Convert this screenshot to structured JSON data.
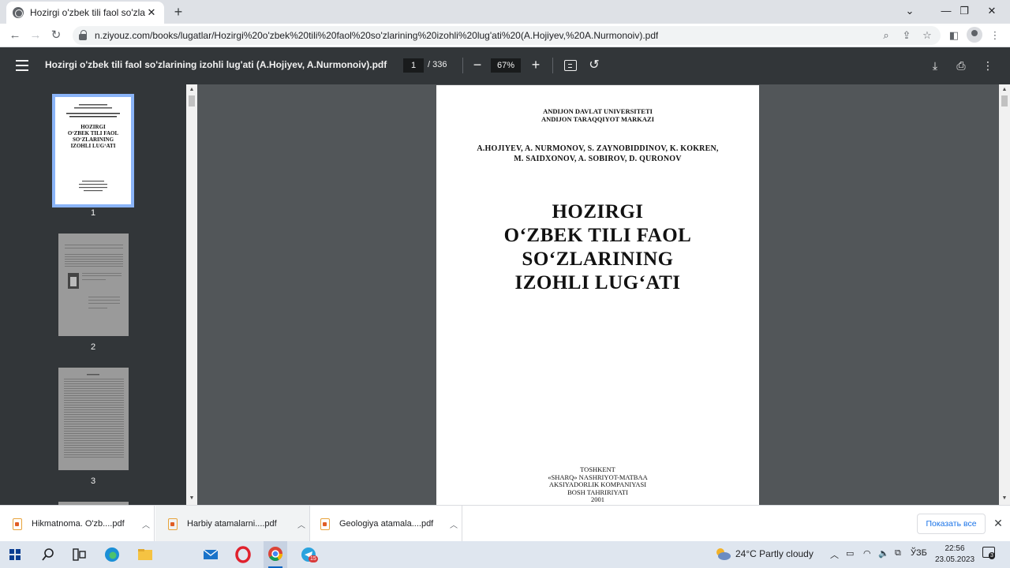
{
  "browser": {
    "tab_title": "Hozirgi o'zbek tili faol so'zlarining",
    "tab_close": "✕",
    "new_tab": "+",
    "url": "n.ziyouz.com/books/lugatlar/Hozirgi%20o'zbek%20tili%20faol%20so'zlarining%20izohli%20lug'ati%20(A.Hojiyev,%20A.Nurmonoiv).pdf",
    "window_controls": [
      "⌄",
      "—",
      "❐",
      "✕"
    ]
  },
  "pdf_toolbar": {
    "title": "Hozirgi o'zbek tili faol so'zlarining izohli lug'ati (A.Hojiyev, A.Nurmonoiv).pdf",
    "current_page": "1",
    "total_pages": "/ 336",
    "zoom": "67%",
    "zoom_out": "−",
    "zoom_in": "+"
  },
  "thumbnails": [
    {
      "label": "1",
      "selected": true
    },
    {
      "label": "2",
      "selected": false
    },
    {
      "label": "3",
      "selected": false
    }
  ],
  "page": {
    "institution": [
      "ANDIJON DAVLAT UNIVERSITETI",
      "ANDIJON TARAQQIYOT MARKAZI"
    ],
    "authors": [
      "A.HOJIYEV, A. NURMONOV, S. ZAYNOBIDDINOV, K. KOKREN,",
      "M. SAIDXONOV, A. SOBIROV, D. QURONOV"
    ],
    "title": [
      "HOZIRGI",
      "O‘ZBEK TILI FAOL",
      "SO‘ZLARINING",
      "IZOHLI LUG‘ATI"
    ],
    "thumb_title": [
      "HOZIRGI",
      "O‘ZBEK TILI FAOL",
      "SO‘ZLARINING",
      "IZOHLI LUG‘ATI"
    ],
    "publisher": [
      "TOSHKENT",
      "«SHARQ» NASHRIYOT-MATBAA",
      "AKSIYADORLIK KOMPANIYASI",
      "BOSH TAHRIRIYATI",
      "2001"
    ]
  },
  "downloads": {
    "items": [
      {
        "name": "Hikmatnoma. O'zb....pdf"
      },
      {
        "name": "Harbiy atamalarni....pdf"
      },
      {
        "name": "Geologiya atamala....pdf"
      }
    ],
    "show_all": "Показать все",
    "close": "✕"
  },
  "taskbar": {
    "weather": "24°C  Partly cloudy",
    "language": "ЎЗБ",
    "time": "22:56",
    "date": "23.05.2023",
    "telegram_badge": "15",
    "notif_count": "3"
  },
  "colors": {
    "pdf_toolbar": "#323639",
    "viewer_bg": "#525659",
    "thumb_selected": "#8ab4f8",
    "link_blue": "#1a73e8"
  }
}
